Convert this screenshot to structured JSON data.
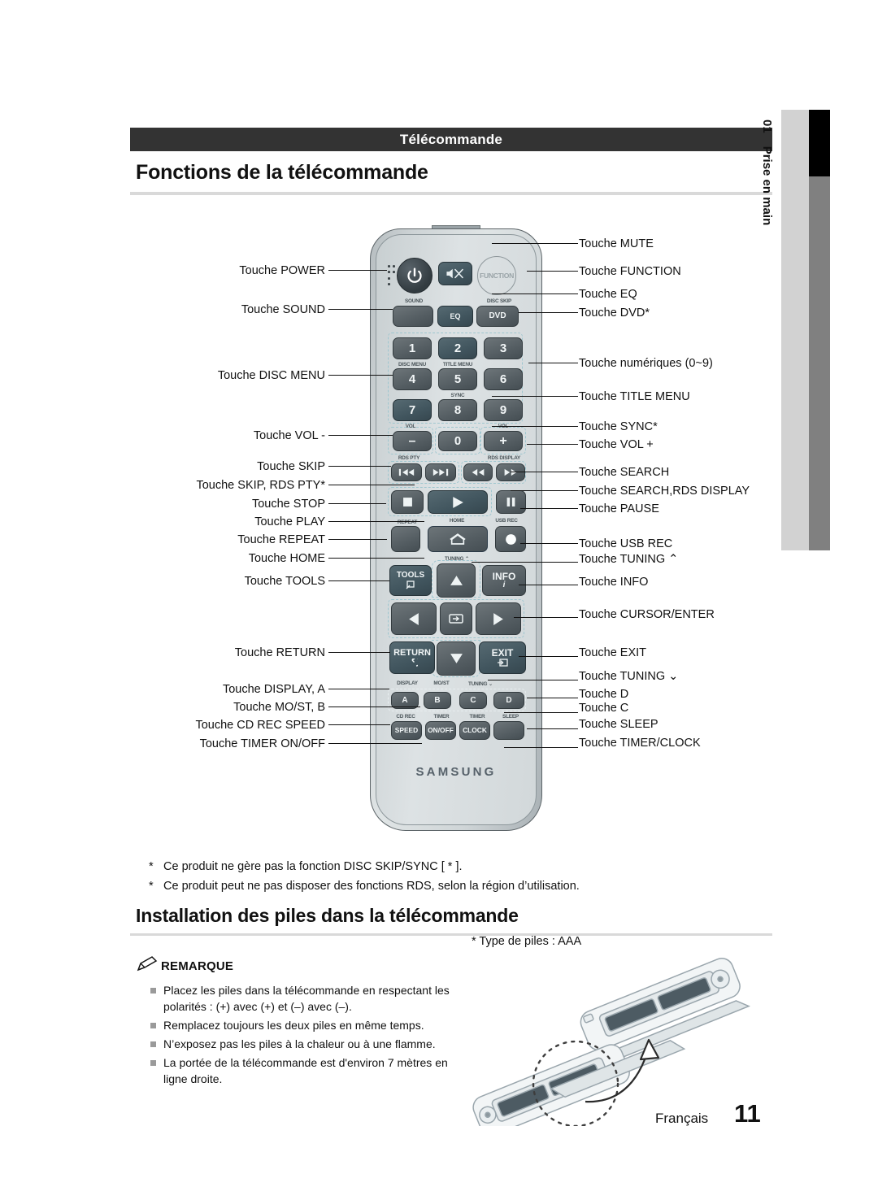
{
  "header": {
    "section_bar": "Télécommande"
  },
  "headings": {
    "h1": "Fonctions de la télécommande",
    "h2": "Installation des piles dans la télécommande"
  },
  "side_tab": {
    "number": "01",
    "label": "Prise en main"
  },
  "callouts_left": [
    {
      "text": "Touche POWER"
    },
    {
      "text": "Touche SOUND"
    },
    {
      "text": "Touche DISC MENU"
    },
    {
      "text": "Touche VOL -"
    },
    {
      "text": "Touche SKIP"
    },
    {
      "text": "Touche SKIP, RDS PTY*"
    },
    {
      "text": "Touche STOP"
    },
    {
      "text": "Touche PLAY"
    },
    {
      "text": "Touche REPEAT"
    },
    {
      "text": "Touche HOME"
    },
    {
      "text": "Touche TOOLS"
    },
    {
      "text": "Touche RETURN"
    },
    {
      "text": "Touche DISPLAY, A"
    },
    {
      "text": "Touche MO/ST, B"
    },
    {
      "text": "Touche CD REC SPEED"
    },
    {
      "text": "Touche TIMER ON/OFF"
    }
  ],
  "callouts_right": [
    {
      "text": "Touche MUTE"
    },
    {
      "text": "Touche FUNCTION"
    },
    {
      "text": "Touche EQ"
    },
    {
      "text": "Touche DVD*"
    },
    {
      "text": "Touche numériques (0~9)"
    },
    {
      "text": "Touche TITLE MENU"
    },
    {
      "text": "Touche SYNC*"
    },
    {
      "text": "Touche VOL +"
    },
    {
      "text": "Touche SEARCH"
    },
    {
      "text": "Touche SEARCH,RDS DISPLAY"
    },
    {
      "text": "Touche PAUSE"
    },
    {
      "text": "Touche USB REC"
    },
    {
      "text": "Touche TUNING ⌃"
    },
    {
      "text": "Touche INFO"
    },
    {
      "text": "Touche CURSOR/ENTER"
    },
    {
      "text": "Touche EXIT"
    },
    {
      "text": "Touche TUNING ⌄"
    },
    {
      "text": "Touche D"
    },
    {
      "text": "Touche C"
    },
    {
      "text": "Touche SLEEP"
    },
    {
      "text": "Touche TIMER/CLOCK"
    }
  ],
  "remote": {
    "brand": "SAMSUNG",
    "function_label": "FUNCTION",
    "small_labels": [
      "SOUND",
      "DISC SKIP",
      "DISC MENU",
      "TITLE MENU",
      "SYNC",
      "VOL",
      "VOL",
      "RDS PTY",
      "RDS DISPLAY",
      "REPEAT",
      "HOME",
      "USB REC",
      "TUNING ⌃",
      "DISPLAY",
      "MO/ST",
      "TUNING ⌄",
      "CD REC",
      "TIMER",
      "TIMER",
      "SLEEP"
    ],
    "numbers": [
      "1",
      "2",
      "3",
      "4",
      "5",
      "6",
      "7",
      "8",
      "9",
      "0"
    ],
    "text_buttons": [
      "EQ",
      "DVD",
      "TOOLS",
      "INFO",
      "RETURN",
      "EXIT",
      "A",
      "B",
      "C",
      "D",
      "SPEED",
      "ON/OFF",
      "CLOCK"
    ],
    "vol_minus": "–",
    "vol_plus": "+"
  },
  "footnotes": [
    {
      "marker": "*",
      "text": "Ce produit ne gère pas la fonction  DISC SKIP/SYNC [ * ]."
    },
    {
      "marker": "*",
      "text": "Ce produit peut ne pas disposer des fonctions RDS, selon la région d’utilisation."
    }
  ],
  "battery": {
    "type_note": "* Type de piles : AAA",
    "note_title": "REMARQUE",
    "notes": [
      "Placez les piles dans la télécommande en respectant les\npolarités : (+) avec (+) et (–) avec (–).",
      "Remplacez toujours les deux piles en même temps.",
      "N’exposez pas les piles à la chaleur ou à une flamme.",
      "La portée de la télécommande est d'environ 7 mètres en\nligne droite."
    ]
  },
  "footer": {
    "language": "Français",
    "page": "11"
  }
}
